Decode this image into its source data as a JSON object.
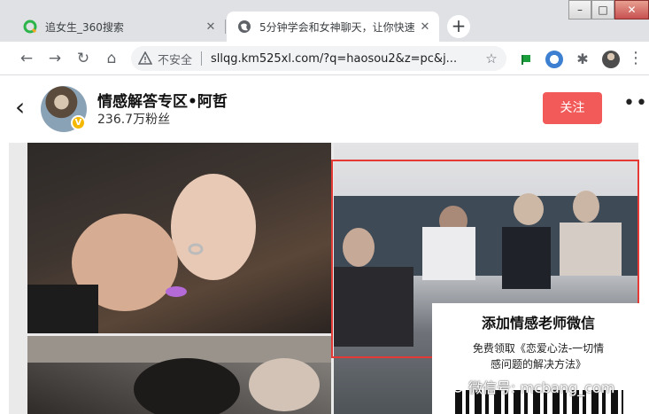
{
  "browser": {
    "tabs": [
      {
        "title": "追女生_360搜索",
        "favicon": "360-search-icon",
        "active": false
      },
      {
        "title": "5分钟学会和女神聊天，让你快速",
        "favicon": "globe-icon",
        "active": true
      }
    ],
    "address": {
      "security_label": "不安全",
      "url": "sllqg.km525xl.com/?q=haosou2&z=pc&j..."
    }
  },
  "profile": {
    "name": "情感解答专区•阿哲",
    "fans": "236.7万粉丝",
    "follow_label": "关注"
  },
  "promo": {
    "title": "添加情感老师微信",
    "subtitle_line1": "免费领取《恋爱心法-一切情",
    "subtitle_line2": "感问题的解决方法》"
  },
  "watermark": {
    "text": "微信号: mcbang_com"
  },
  "colors": {
    "follow_button": "#f25a5a",
    "highlight_border": "#e53935",
    "tab_strip": "#dfe1e5"
  }
}
